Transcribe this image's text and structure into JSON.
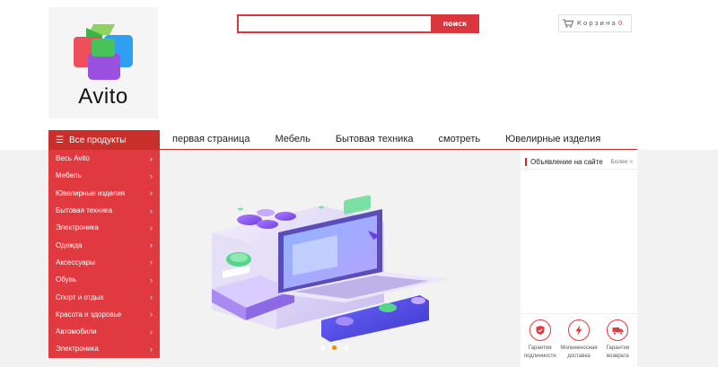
{
  "logo": {
    "text": "Avito"
  },
  "search": {
    "placeholder": "",
    "button_label": "поиск"
  },
  "cart": {
    "label": "Корзина",
    "count": "0"
  },
  "nav": {
    "all_products": "Все продукты",
    "links": [
      "первая страница",
      "Мебель",
      "Бытовая техника",
      "смотреть",
      "Ювелирные изделия"
    ]
  },
  "sidebar": {
    "items": [
      {
        "label": "Весь Avito"
      },
      {
        "label": "Мебель"
      },
      {
        "label": "Ювелирные изделия"
      },
      {
        "label": "Бытовая техника"
      },
      {
        "label": "Электроника"
      },
      {
        "label": "Одежда"
      },
      {
        "label": "Аксессуары"
      },
      {
        "label": "Обувь"
      },
      {
        "label": "Спорт и отдых"
      },
      {
        "label": "Красота и здоровье"
      },
      {
        "label": "Автомобили"
      },
      {
        "label": "Электроника"
      }
    ],
    "arrow": "›"
  },
  "carousel": {
    "slides": 3,
    "active": 2
  },
  "right_panel": {
    "title": "Объявление на сайте",
    "more": "Более >",
    "guarantees": [
      {
        "icon": "shield-icon",
        "label_line1": "Гарантия",
        "label_line2": "подлинности"
      },
      {
        "icon": "lightning-icon",
        "label_line1": "Молниеносная",
        "label_line2": "доставка"
      },
      {
        "icon": "truck-icon",
        "label_line1": "Гарантия",
        "label_line2": "возврата"
      }
    ]
  },
  "colors": {
    "accent": "#d9363e",
    "sidebar": "#e0393f",
    "band": "#f2f2f2",
    "dot_active": "#f08a00"
  }
}
